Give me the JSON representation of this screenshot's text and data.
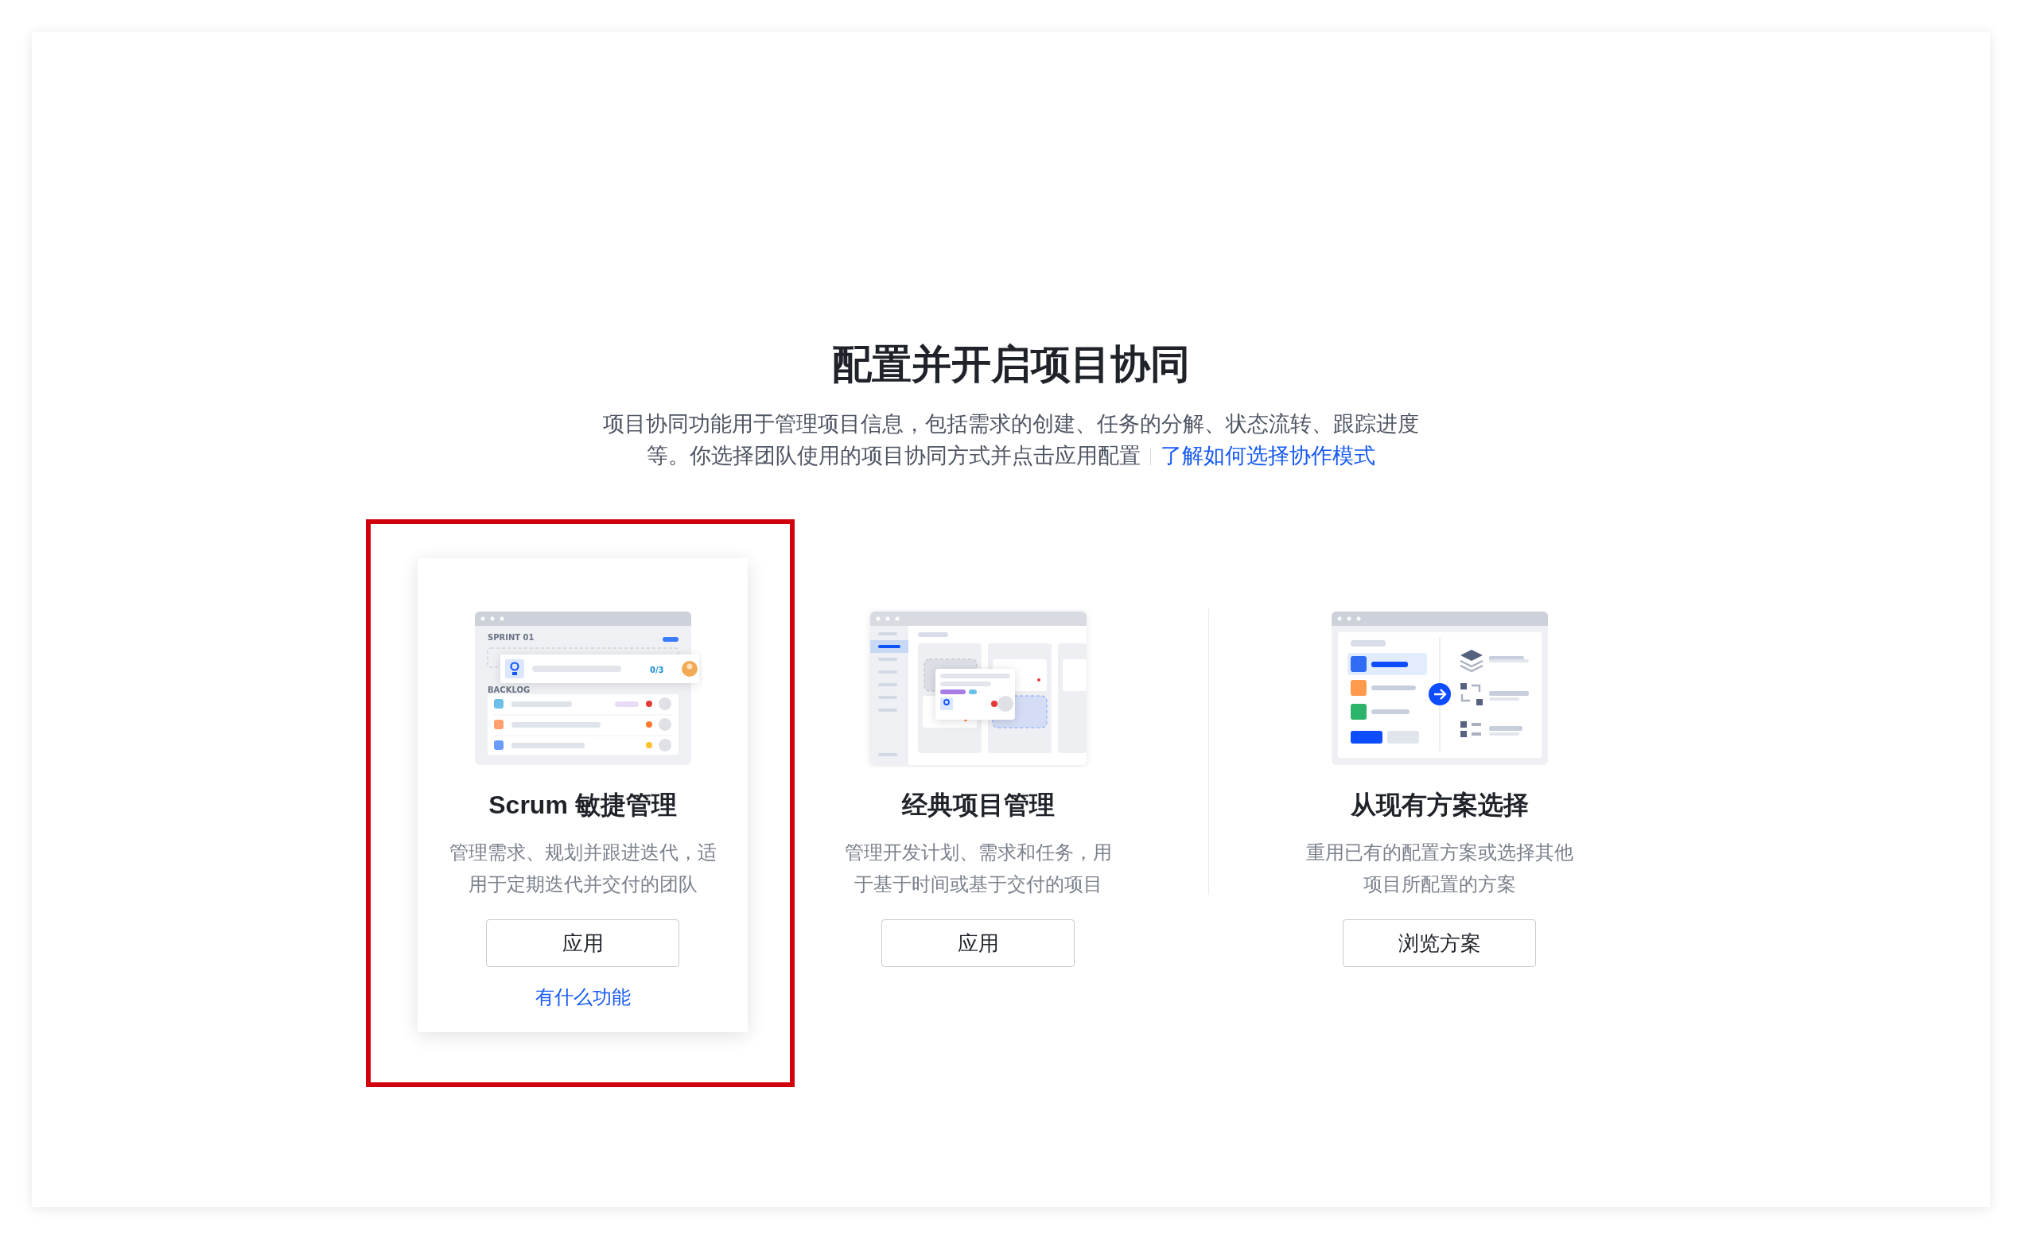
{
  "page": {
    "title": "配置并开启项目协同",
    "description": "项目协同功能用于管理项目信息，包括需求的创建、任务的分解、状态流转、跟踪进度等。你选择团队使用的项目协同方式并点击应用配置",
    "help_link": "了解如何选择协作模式"
  },
  "cards": [
    {
      "illustration": {
        "kind": "scrum",
        "sprint_label": "SPRINT 01",
        "progress": "0/3",
        "backlog_label": "BACKLOG"
      },
      "title": "Scrum 敏捷管理",
      "description": "管理需求、规划并跟进迭代，适用于定期迭代并交付的团队",
      "button": "应用",
      "link": "有什么功能",
      "selected": true,
      "annotated": true
    },
    {
      "illustration": {
        "kind": "classic"
      },
      "title": "经典项目管理",
      "description": "管理开发计划、需求和任务，用于基于时间或基于交付的项目",
      "button": "应用",
      "selected": false,
      "annotated": false
    },
    {
      "illustration": {
        "kind": "scheme"
      },
      "title": "从现有方案选择",
      "description": "重用已有的配置方案或选择其他项目所配置的方案",
      "button": "浏览方案",
      "selected": false,
      "annotated": false
    }
  ]
}
